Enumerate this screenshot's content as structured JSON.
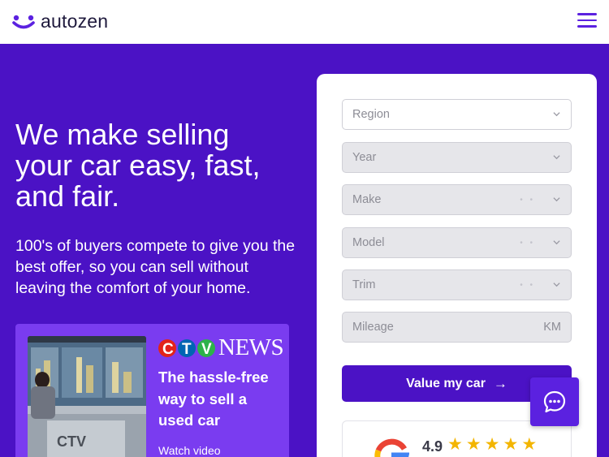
{
  "header": {
    "brand": "autozen",
    "menu_icon": "hamburger-menu-icon"
  },
  "hero": {
    "headline": "We make selling your car easy, fast, and fair.",
    "subtext": "100's of buyers compete to give you the best offer, so you can sell without leaving the comfort of your home."
  },
  "news": {
    "logo_letters": [
      "C",
      "T",
      "V"
    ],
    "logo_word": "NEWS",
    "title": "The hassle-free way to sell a used car",
    "link": "Watch video",
    "thumb_logo": "CTV"
  },
  "form": {
    "region": {
      "placeholder": "Region"
    },
    "year": {
      "placeholder": "Year"
    },
    "make": {
      "placeholder": "Make"
    },
    "model": {
      "placeholder": "Model"
    },
    "trim": {
      "placeholder": "Trim"
    },
    "mileage": {
      "placeholder": "Mileage",
      "unit": "KM"
    },
    "submit_label": "Value my car"
  },
  "rating": {
    "score": "4.9",
    "stars": 5
  },
  "colors": {
    "brand_purple": "#4b12c5",
    "accent_purple": "#5b21e0",
    "star": "#f3b500"
  },
  "chat": {
    "icon": "chat-bubble-icon"
  }
}
